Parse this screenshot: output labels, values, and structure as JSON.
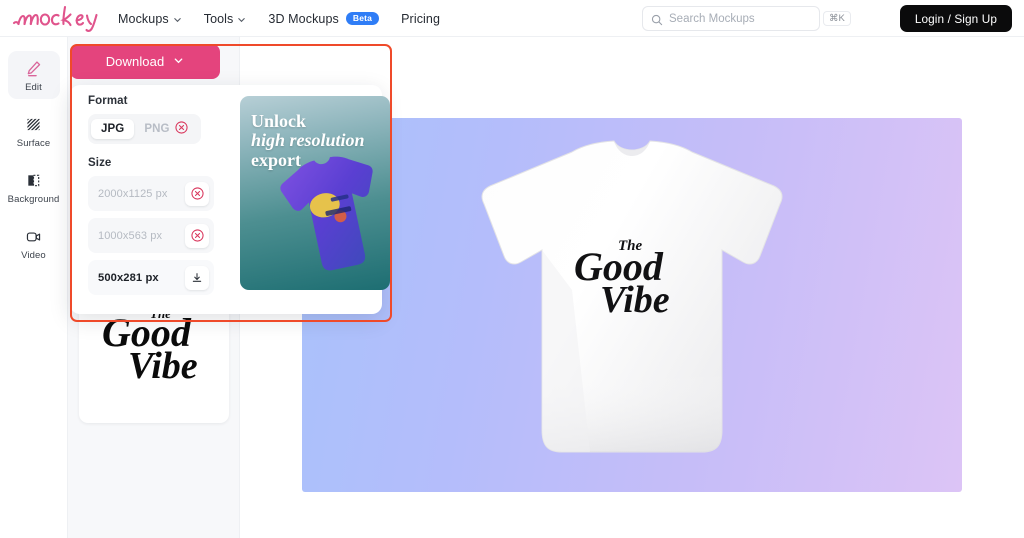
{
  "brand": {
    "name": "mockey",
    "logo_color": "#e0548c"
  },
  "header": {
    "nav": [
      {
        "label": "Mockups",
        "icon": "chevron-down-icon",
        "has_caret": true,
        "badge": ""
      },
      {
        "label": "Tools",
        "icon": "chevron-down-icon",
        "has_caret": true,
        "badge": ""
      },
      {
        "label": "3D Mockups",
        "icon": "",
        "has_caret": false,
        "badge": "Beta"
      },
      {
        "label": "Pricing",
        "icon": "",
        "has_caret": false,
        "badge": ""
      }
    ],
    "search": {
      "placeholder": "Search Mockups",
      "value": "",
      "shortcut": "⌘K",
      "icon": "search-icon"
    },
    "login_label": "Login / Sign Up",
    "badge_color": "#2f7df6",
    "login_bg": "#0b0b0c"
  },
  "sidebar": {
    "items": [
      {
        "label": "Edit",
        "icon": "pencil-icon",
        "active": true
      },
      {
        "label": "Surface",
        "icon": "hatch-pattern-icon",
        "active": false
      },
      {
        "label": "Background",
        "icon": "half-fill-square-icon",
        "active": false
      },
      {
        "label": "Video",
        "icon": "video-camera-icon",
        "active": false
      }
    ]
  },
  "download": {
    "button_label": "Download",
    "button_color": "#e4447d",
    "caret_icon": "chevron-down-icon",
    "format": {
      "section_label": "Format",
      "options": [
        {
          "label": "JPG",
          "selected": true,
          "locked": false,
          "icon": ""
        },
        {
          "label": "PNG",
          "selected": false,
          "locked": true,
          "icon": "locked-circle-x-icon"
        }
      ]
    },
    "size": {
      "section_label": "Size",
      "rows": [
        {
          "label": "2000x1125 px",
          "locked": true,
          "icon": "locked-circle-x-icon"
        },
        {
          "label": "1000x563 px",
          "locked": true,
          "icon": "locked-circle-x-icon"
        },
        {
          "label": "500x281 px",
          "locked": false,
          "icon": "download-arrow-icon"
        }
      ]
    },
    "promo": {
      "line1": "Unlock",
      "line2": "high resolution",
      "line3": "export",
      "art": "purple-tshirt-mockup"
    },
    "highlight_color": "#ef4a2a"
  },
  "canvas": {
    "artboard_gradient_from": "#a9c2fb",
    "artboard_gradient_to": "#dcc4f6",
    "mockup": {
      "product": "white-tshirt",
      "design_text_line1": "The",
      "design_text_line2": "Good",
      "design_text_line3": "Vibe"
    }
  },
  "thumbnail_card": {
    "design": "the-good-vibe-lettering"
  }
}
